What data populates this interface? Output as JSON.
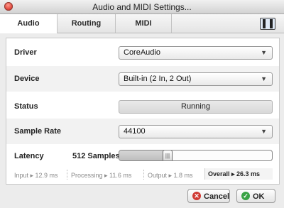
{
  "window": {
    "title": "Audio and MIDI Settings..."
  },
  "tabs": [
    {
      "label": "Audio",
      "active": true
    },
    {
      "label": "Routing",
      "active": false
    },
    {
      "label": "MIDI",
      "active": false
    }
  ],
  "layout_icon": "panel-layout-icon",
  "settings": {
    "driver": {
      "label": "Driver",
      "value": "CoreAudio"
    },
    "device": {
      "label": "Device",
      "value": "Built-in (2 In, 2 Out)"
    },
    "status": {
      "label": "Status",
      "value": "Running"
    },
    "sample_rate": {
      "label": "Sample Rate",
      "value": "44100"
    },
    "latency": {
      "label": "Latency",
      "samples": "512 Samples",
      "slider_fraction": 0.3
    }
  },
  "stats": {
    "input": "Input ▸ 12.9 ms",
    "processing": "Processing  ▸ 11.6 ms",
    "output": "Output ▸ 1.8 ms",
    "overall": "Overall  ▸ 26.3 ms"
  },
  "buttons": {
    "cancel": "Cancel",
    "ok": "OK"
  },
  "colors": {
    "cancel_icon": "#d03a33",
    "ok_icon": "#3aa346"
  }
}
